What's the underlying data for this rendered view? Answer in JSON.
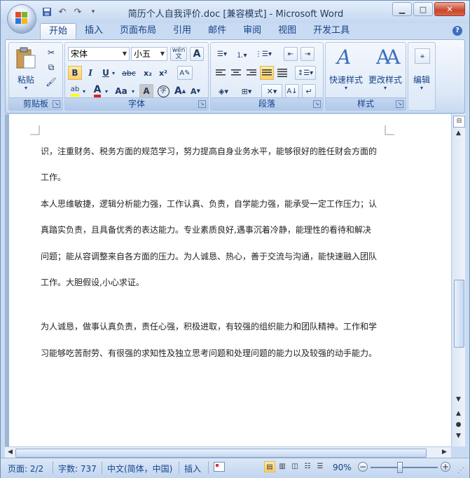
{
  "titlebar": {
    "title": "简历个人自我评价.doc [兼容模式] - Microsoft Word",
    "minimize_icon": "minimize-icon",
    "maximize_icon": "maximize-icon",
    "close_icon": "close-icon"
  },
  "tabs": [
    "开始",
    "插入",
    "页面布局",
    "引用",
    "邮件",
    "审阅",
    "视图",
    "开发工具"
  ],
  "ribbon": {
    "clipboard": {
      "label": "剪贴板",
      "paste": "粘贴"
    },
    "font": {
      "label": "字体",
      "font_name": "宋体",
      "font_size": "小五",
      "bold": "B",
      "italic": "I",
      "underline": "U",
      "strike": "abc",
      "sub": "x₂",
      "sup": "x²",
      "change_case": "Aa",
      "char_border": "A",
      "phonetic": "wén 文",
      "grow": "A",
      "shrink": "A",
      "enclose": "字"
    },
    "paragraph": {
      "label": "段落"
    },
    "styles": {
      "label": "样式",
      "quick_styles": "快速样式",
      "change_styles": "更改样式"
    },
    "editing": {
      "label": "编辑"
    }
  },
  "document": {
    "lines": [
      "识，注重财务、税务方面的规范学习，努力提高自身业务水平，能够很好的胜任财会方面的",
      "工作。",
      "本人思维敏捷，逻辑分析能力强，工作认真、负责，自学能力强，能承受一定工作压力；认",
      "真踏实负责，且具备优秀的表达能力。专业素质良好,遇事沉着冷静，能理性的看待和解决",
      "问题；能从容调整来自各方面的压力。为人诚恳、热心，善于交流与沟通，能快速融入团队",
      "工作。大胆假设,小心求证。",
      "",
      "为人诚恳，做事认真负责，责任心强，积极进取，有较强的组织能力和团队精神。工作和学",
      "习能够吃苦耐劳、有很强的求知性及独立思考问题和处理问题的能力以及较强的动手能力。"
    ]
  },
  "status": {
    "page": "页面: 2/2",
    "words": "字数: 737",
    "language": "中文(简体，中国)",
    "mode": "插入",
    "zoom": "90%",
    "zoom_value": 90
  },
  "colors": {
    "accent": "#15428b",
    "highlight": "#ffff00",
    "font_color": "#e02020"
  }
}
